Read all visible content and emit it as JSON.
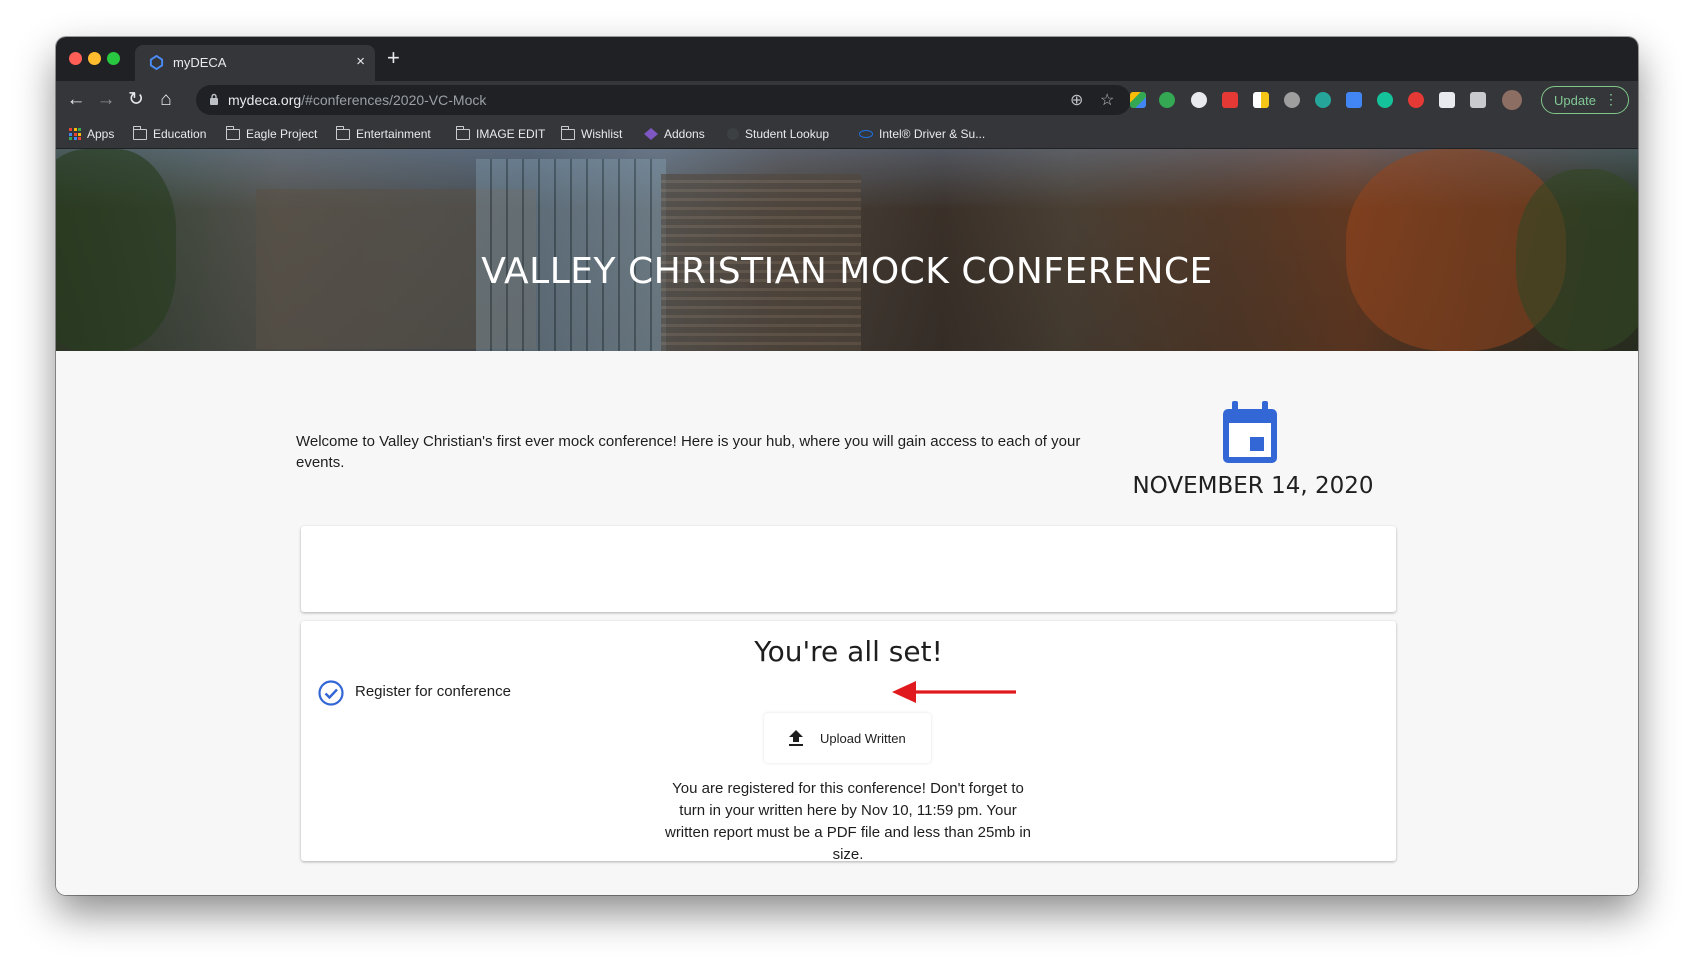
{
  "browser": {
    "tab_title": "myDECA",
    "tab_close": "×",
    "new_tab": "+",
    "url_domain": "mydeca.org",
    "url_path": "/#conferences/2020-VC-Mock",
    "update_label": "Update",
    "update_menu": "⋮",
    "nav": {
      "back": "←",
      "forward": "→",
      "reload": "↻",
      "home": "⌂"
    }
  },
  "bookmarks": [
    {
      "label": "Apps",
      "icon": "apps-grid-icon"
    },
    {
      "label": "Education",
      "icon": "folder-icon"
    },
    {
      "label": "Eagle Project",
      "icon": "folder-icon"
    },
    {
      "label": "Entertainment",
      "icon": "folder-icon"
    },
    {
      "label": "IMAGE EDIT",
      "icon": "folder-icon"
    },
    {
      "label": "Wishlist",
      "icon": "folder-icon"
    },
    {
      "label": "Addons",
      "icon": "addons-icon"
    },
    {
      "label": "Student Lookup",
      "icon": "globe-icon"
    },
    {
      "label": "Intel® Driver & Su...",
      "icon": "intel-icon"
    }
  ],
  "page": {
    "hero_title": "VALLEY CHRISTIAN MOCK CONFERENCE",
    "welcome": "Welcome to Valley Christian's first ever mock conference! Here is your hub, where you will gain access to each of your events.",
    "date": "NOVEMBER 14, 2020",
    "status_heading": "You're all set!",
    "register_label": "Register for conference",
    "upload_label": "Upload Written",
    "registered_text": "You are registered for this conference! Don't forget to turn in your written here by Nov 10, 11:59 pm. Your written report must be a PDF file and less than 25mb in size."
  },
  "colors": {
    "accent_blue": "#3367d6",
    "arrow_red": "#e0191e",
    "update_green": "#81c995"
  }
}
